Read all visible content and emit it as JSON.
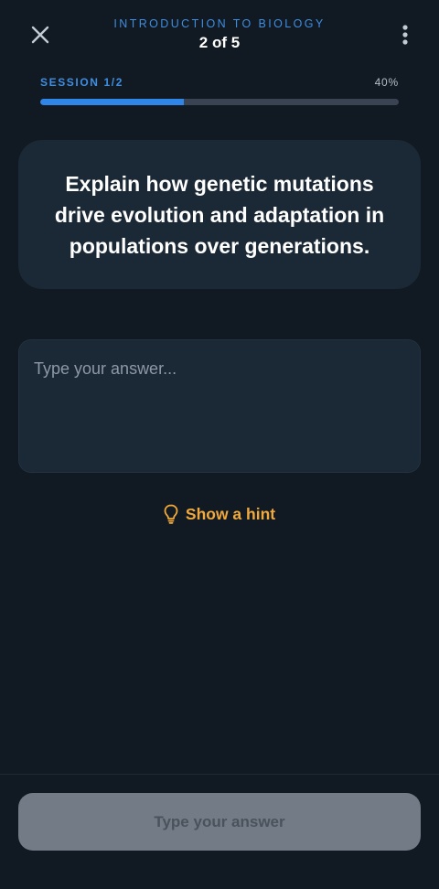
{
  "header": {
    "course_title": "INTRODUCTION TO BIOLOGY",
    "step_count": "2 of 5",
    "close_icon": "close-icon",
    "menu_icon": "more-vertical-icon"
  },
  "progress": {
    "session_label": "SESSION 1/2",
    "percent_label": "40%",
    "percent_value": 0.4,
    "colors": {
      "fill": "#2f86e8",
      "track": "#3a4351"
    }
  },
  "question": {
    "text": "Explain how genetic mutations drive evolution and adaptation in populations over generations."
  },
  "answer": {
    "value": "",
    "placeholder": "Type your answer..."
  },
  "hint": {
    "label": "Show a hint",
    "icon": "lightbulb-icon",
    "color": "#f2a93b"
  },
  "footer": {
    "submit_label": "Type your answer",
    "submit_disabled": true
  },
  "colors": {
    "background": "#111a22",
    "card": "#1b2835",
    "accent": "#3f8de0"
  }
}
